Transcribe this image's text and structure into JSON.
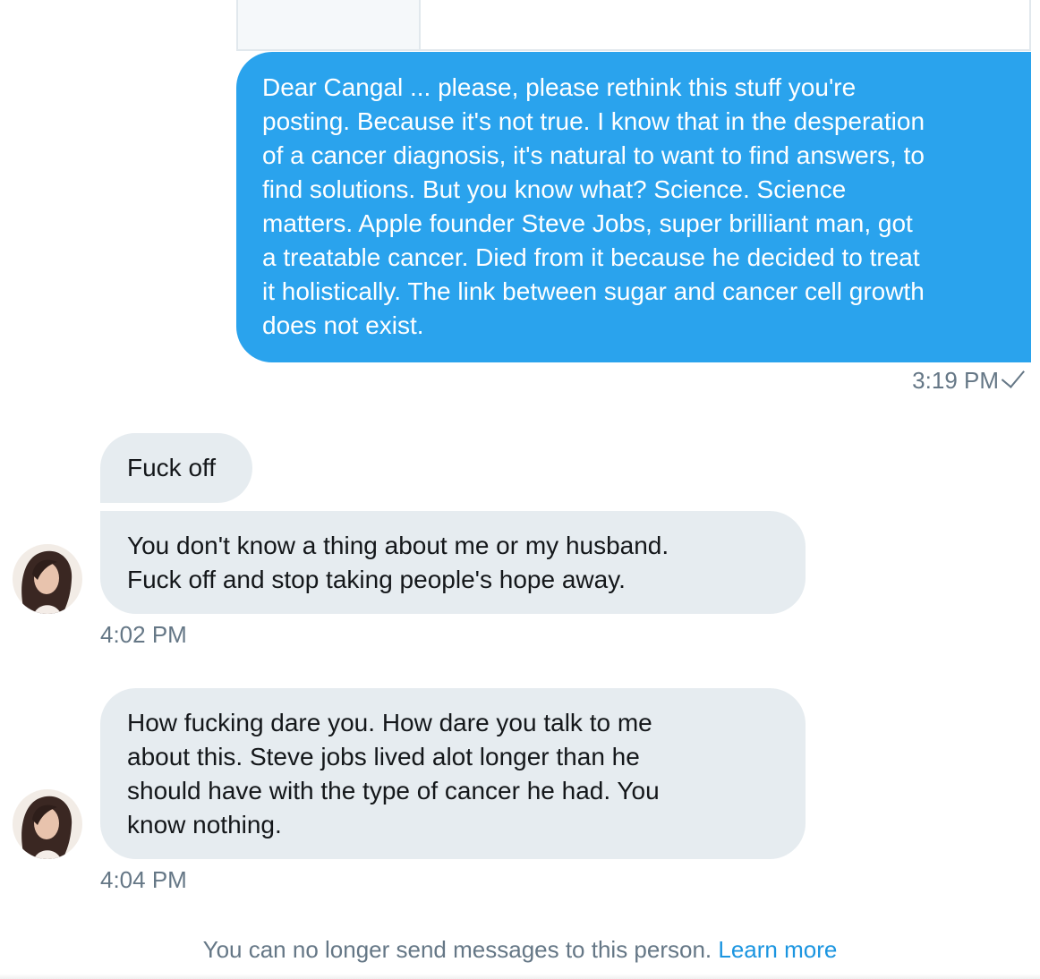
{
  "conversation": {
    "sent_message": {
      "text": "Dear Cangal ... please, please rethink this stuff you're\nposting. Because it's not true. I know that in the desperation\nof a cancer diagnosis, it's natural to want to find answers, to\nfind solutions. But you know what? Science. Science\nmatters. Apple founder Steve Jobs, super brilliant man, got\na treatable cancer. Died from it because he decided to treat\nit holistically. The link between sugar and cancer cell growth\ndoes not exist.",
      "time": "3:19 PM",
      "status_icon": "check-icon"
    },
    "received_groups": [
      {
        "messages": [
          "Fuck off",
          "You don't know a thing about me or my husband.\nFuck off and stop taking people's hope away."
        ],
        "time": "4:02 PM"
      },
      {
        "messages": [
          "How fucking dare you. How dare you talk to me\nabout this. Steve jobs lived alot longer than he\nshould have with the type of cancer he had. You\nknow nothing."
        ],
        "time": "4:04 PM"
      }
    ],
    "footer": {
      "notice": "You can no longer send messages to this person.",
      "link": "Learn more"
    }
  },
  "colors": {
    "sent_bubble": "#2aa3ed",
    "received_bubble": "#e6ecf0",
    "secondary_text": "#657786",
    "link": "#1b95e0"
  }
}
